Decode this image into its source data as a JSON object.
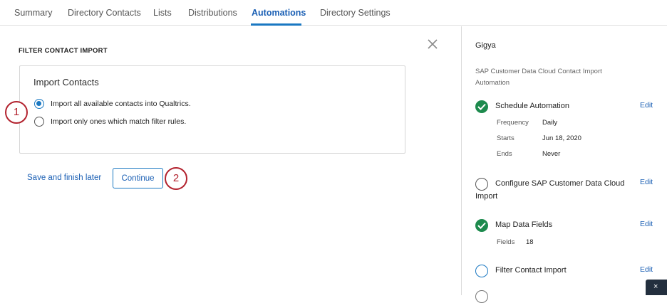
{
  "tabs": [
    {
      "label": "Summary"
    },
    {
      "label": "Directory Contacts"
    },
    {
      "label": "Lists"
    },
    {
      "label": "Distributions"
    },
    {
      "label": "Automations"
    },
    {
      "label": "Directory Settings"
    }
  ],
  "active_tab": "Automations",
  "main": {
    "heading": "FILTER CONTACT IMPORT",
    "panel_title": "Import Contacts",
    "options": [
      {
        "label": "Import all available contacts into Qualtrics.",
        "selected": true
      },
      {
        "label": "Import only ones which match filter rules.",
        "selected": false
      }
    ],
    "save_link": "Save and finish later",
    "continue_label": "Continue",
    "callouts": [
      "1",
      "2"
    ]
  },
  "sidebar": {
    "title": "Gigya",
    "subtitle": "SAP Customer Data Cloud Contact Import Automation",
    "edit_label": "Edit",
    "steps": [
      {
        "label": "Schedule Automation",
        "status": "complete",
        "details": [
          {
            "key": "Frequency",
            "value": "Daily"
          },
          {
            "key": "Starts",
            "value": "Jun 18, 2020"
          },
          {
            "key": "Ends",
            "value": "Never"
          }
        ]
      },
      {
        "label": "Configure SAP Customer Data Cloud Import",
        "status": "incomplete"
      },
      {
        "label": "Map Data Fields",
        "status": "complete",
        "details": [
          {
            "key": "Fields",
            "value": "18"
          }
        ]
      },
      {
        "label": "Filter Contact Import",
        "status": "current"
      }
    ]
  },
  "colors": {
    "accent": "#1a78c2",
    "success": "#1d8a4d",
    "callout": "#b3232f"
  },
  "close_icon": "close-icon"
}
